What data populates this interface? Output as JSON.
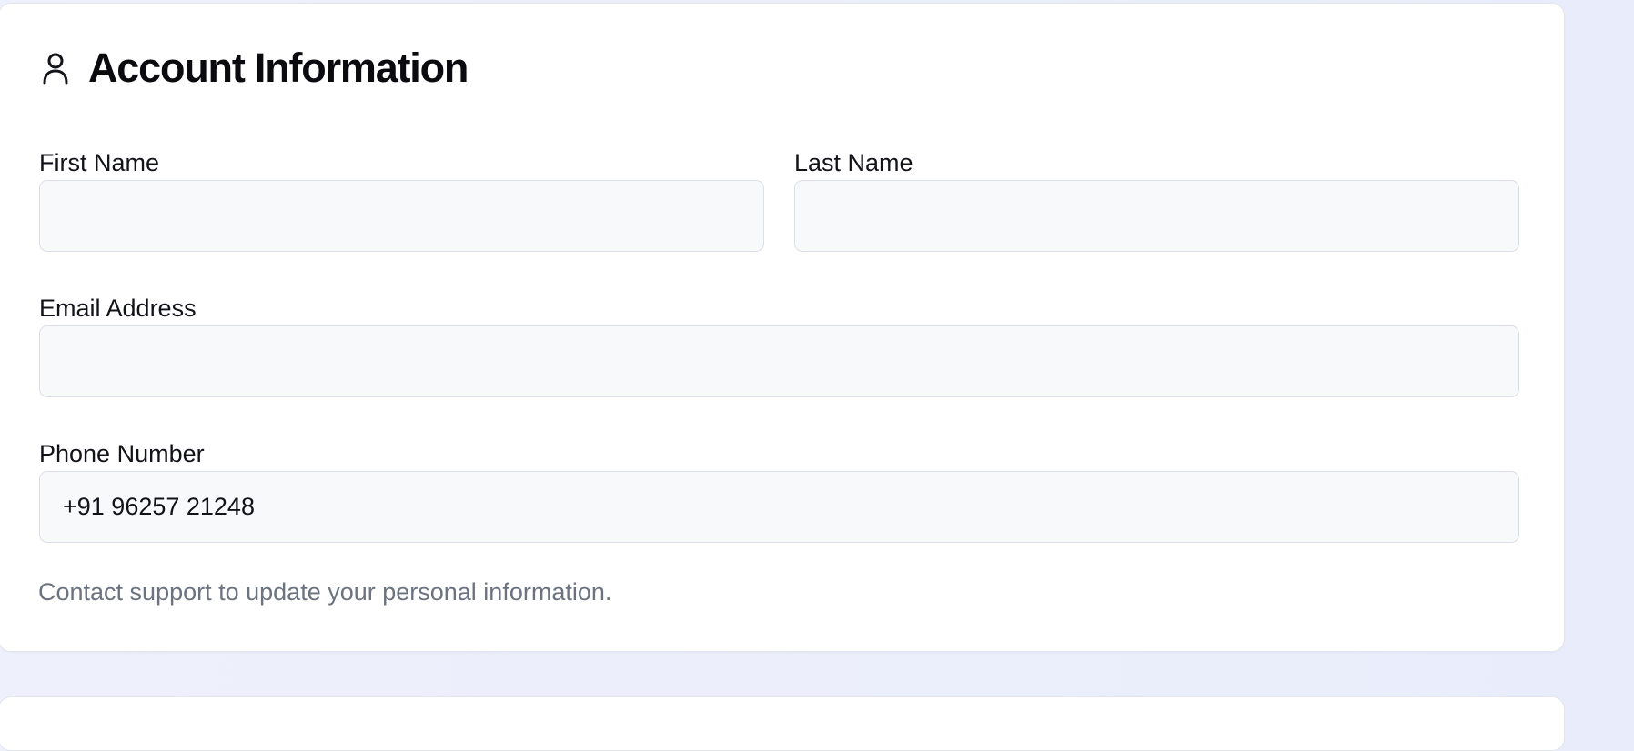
{
  "account_info": {
    "title": "Account Information",
    "icon": "user-icon",
    "fields": {
      "first_name": {
        "label": "First Name",
        "value": ""
      },
      "last_name": {
        "label": "Last Name",
        "value": ""
      },
      "email": {
        "label": "Email Address",
        "value": ""
      },
      "phone": {
        "label": "Phone Number",
        "value": "+91 96257 21248"
      }
    },
    "help_text": "Contact support to update your personal information."
  },
  "colors": {
    "page_background": "#e9edfb",
    "card_background": "#ffffff",
    "field_background": "#f8f9fb",
    "field_border": "#dcdfe6",
    "muted_text": "#6b7280"
  }
}
